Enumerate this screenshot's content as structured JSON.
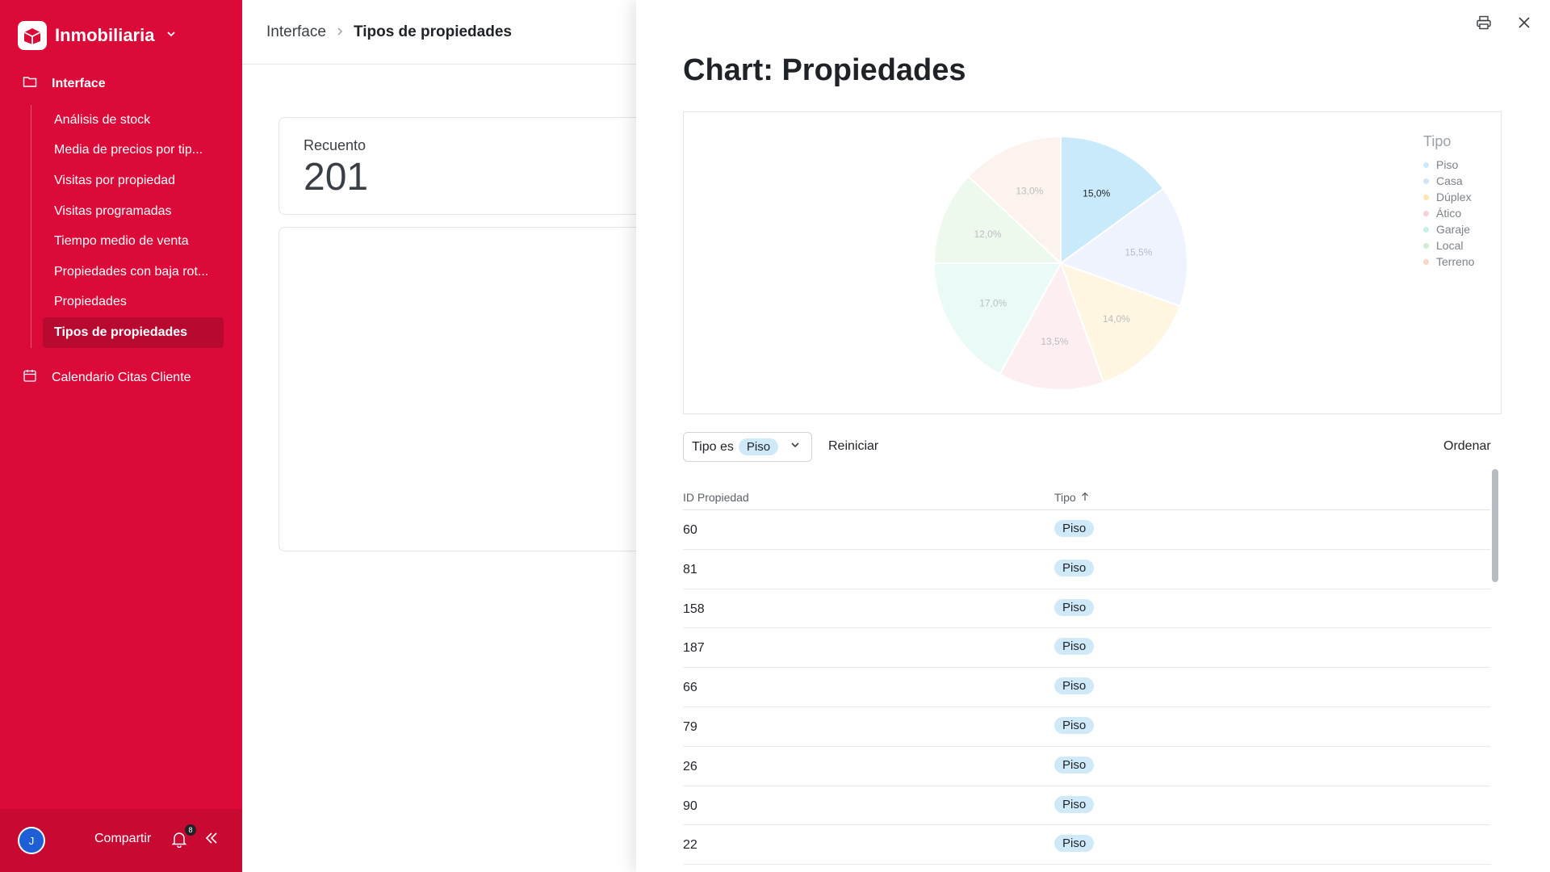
{
  "app": {
    "name": "Inmobiliaria"
  },
  "sidebar": {
    "group_label": "Interface",
    "items": [
      {
        "label": "Análisis de stock"
      },
      {
        "label": "Media de precios por tip..."
      },
      {
        "label": "Visitas por propiedad"
      },
      {
        "label": "Visitas programadas"
      },
      {
        "label": "Tiempo medio de venta"
      },
      {
        "label": "Propiedades con baja rot..."
      },
      {
        "label": "Propiedades"
      },
      {
        "label": "Tipos de propiedades",
        "active": true
      }
    ],
    "calendar_label": "Calendario Citas Cliente",
    "footer": {
      "avatar_initial": "J",
      "share_label": "Compartir",
      "notification_count": "8"
    }
  },
  "breadcrumb": {
    "root": "Interface",
    "current": "Tipos de propiedades"
  },
  "metric": {
    "label": "Recuento",
    "value": "201"
  },
  "drawer": {
    "title": "Chart: Propiedades",
    "filter": {
      "field_label": "Tipo es",
      "value": "Piso"
    },
    "reset_label": "Reiniciar",
    "sort_label": "Ordenar",
    "table": {
      "columns": [
        "ID Propiedad",
        "Tipo"
      ],
      "rows": [
        {
          "id": "60",
          "tipo": "Piso"
        },
        {
          "id": "81",
          "tipo": "Piso"
        },
        {
          "id": "158",
          "tipo": "Piso"
        },
        {
          "id": "187",
          "tipo": "Piso"
        },
        {
          "id": "66",
          "tipo": "Piso"
        },
        {
          "id": "79",
          "tipo": "Piso"
        },
        {
          "id": "26",
          "tipo": "Piso"
        },
        {
          "id": "90",
          "tipo": "Piso"
        },
        {
          "id": "22",
          "tipo": "Piso"
        }
      ]
    }
  },
  "chart_data": {
    "type": "pie",
    "legend_title": "Tipo",
    "legend_placement": "top-right",
    "categories": [
      "Piso",
      "Casa",
      "Dúplex",
      "Ático",
      "Garaje",
      "Local",
      "Terreno"
    ],
    "values": [
      15.0,
      15.5,
      14.0,
      13.5,
      17.0,
      12.0,
      13.0
    ],
    "labels": [
      "15,0%",
      "15,5%",
      "14,0%",
      "13,5%",
      "17,0%",
      "12,0%",
      "13,0%"
    ],
    "colors": [
      "#c9eafb",
      "#eef3fd",
      "#fff6e2",
      "#fdeff1",
      "#eafbf7",
      "#eef9ee",
      "#fdf3ee"
    ],
    "legend_colors": [
      "#c9eafb",
      "#cfe4f6",
      "#fbe7b5",
      "#f8cfd7",
      "#c5f0e6",
      "#cdeed0",
      "#f9d6c6"
    ],
    "highlighted": "Piso"
  }
}
